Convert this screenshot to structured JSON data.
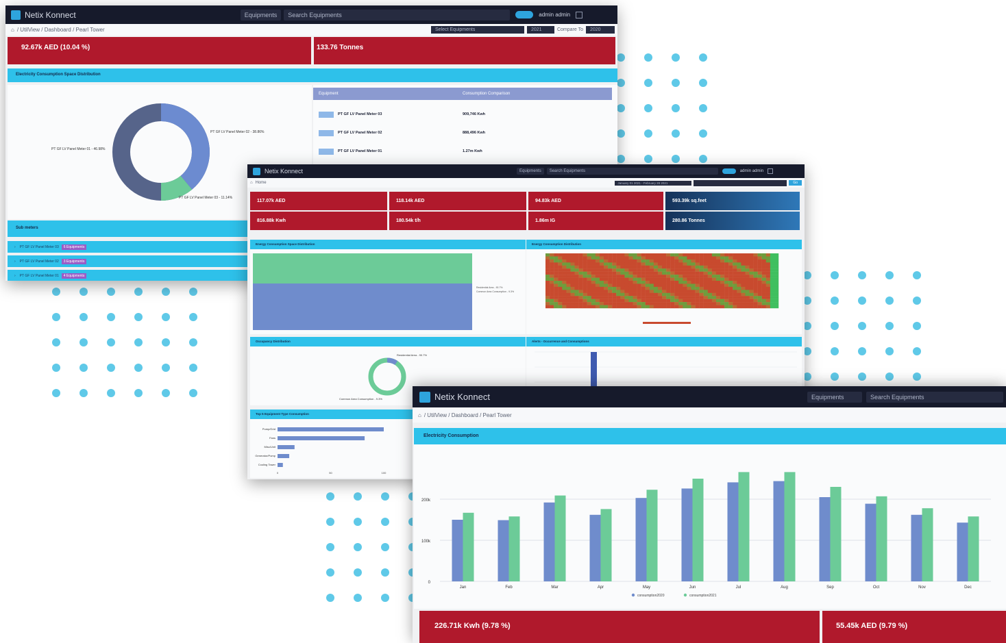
{
  "app": {
    "brand": "Netix Konnect"
  },
  "colors": {
    "accent": "#2ec1ea",
    "card_red": "#b0192c",
    "series_2020": "#6f8ccc",
    "series_2021": "#6ccb98",
    "topbar": "#161a2b"
  },
  "back": {
    "nav_equipments": "Equipments",
    "nav_search": "Search Equipments",
    "user": "admin admin",
    "breadcrumb": "/ UtilView / Dashboard / Pearl Tower",
    "filter_equipment": "Select Equipments",
    "filter_year": "2021",
    "compare_label": "Compare To",
    "compare_year": "2020",
    "card1": {
      "value": "92.67k AED (10.04 %)"
    },
    "card2": {
      "value": "133.76 Tonnes"
    },
    "section_title": "Electricity Consumption Space Distribution",
    "donut_labels": [
      "PT GF LV Panel Meter 01 - 46.98%",
      "PT GF LV Panel Meter 02 - 38.86%",
      "PT GF LV Panel Meter 03 - 11.14%"
    ],
    "table_headers": [
      "Equipment",
      "Consumption Comparison"
    ],
    "table_rows": [
      {
        "name": "PT GF LV Panel Meter 03",
        "value": "909,746 Kwh"
      },
      {
        "name": "PT GF LV Panel Meter 02",
        "value": "888,496 Kwh"
      },
      {
        "name": "PT GF LV Panel Meter 01",
        "value": "1.27m Kwh"
      }
    ],
    "sub_meters_title": "Sub meters",
    "sub_rows": [
      {
        "name": "PT GF LV Panel Meter 03",
        "badge": "6 Equipments"
      },
      {
        "name": "PT GF LV Panel Meter 02",
        "badge": "3 Equipments"
      },
      {
        "name": "PT GF LV Panel Meter 01",
        "badge": "4 Equipments"
      }
    ]
  },
  "middle": {
    "nav_equipments": "Equipments",
    "nav_search": "Search Equipments",
    "user": "admin admin",
    "breadcrumb": "Home",
    "date_range": "January 01 2021 - February 28 2021",
    "action": "Go",
    "kpis": [
      {
        "value": "117.07k AED"
      },
      {
        "value": "118.14k AED"
      },
      {
        "value": "94.83k AED"
      },
      {
        "value": "593.39k sq.feet"
      },
      {
        "value": "816.88k Kwh"
      },
      {
        "value": "180.54k t/h"
      },
      {
        "value": "1.86m IG"
      },
      {
        "value": "280.86 Tonnes"
      }
    ],
    "panels": {
      "space": "Energy Consumption Space Distribution",
      "heatmap": "Energy Consumption Distribution",
      "occupancy": "Occupancy Distribution",
      "top": "Top 5 Equipment Type Consumption",
      "alerts": "Alerts - Occurrence and Consumptions"
    },
    "donut_labels": [
      "Residential Area - 90.7%",
      "Common Area Consumption - 9.3%"
    ],
    "hbar_categories": [
      "Pump/Grid",
      "Fans",
      "Misc/Unit",
      "Generator/Pump",
      "Cooling Tower"
    ],
    "hbar_values": [
      100,
      82,
      16,
      11,
      5
    ],
    "hbar_ticks": [
      "0",
      "50",
      "100"
    ]
  },
  "front": {
    "nav_equipments": "Equipments",
    "nav_search": "Search Equipments",
    "breadcrumb": "/ UtilView / Dashboard / Pearl Tower",
    "section_title": "Electricity Consumption",
    "card1": {
      "value": "226.71k Kwh (9.78 %)"
    },
    "card2": {
      "value": "55.45k AED (9.79 %)"
    }
  },
  "chart_data": {
    "type": "bar",
    "categories": [
      "Jan",
      "Feb",
      "Mar",
      "Apr",
      "May",
      "Jun",
      "Jul",
      "Aug",
      "Sep",
      "Oct",
      "Nov",
      "Dec"
    ],
    "series": [
      {
        "name": "consumption2020",
        "values": [
          150,
          149,
          192,
          162,
          203,
          226,
          241,
          244,
          205,
          189,
          162,
          143
        ]
      },
      {
        "name": "consumption2021",
        "values": [
          167,
          158,
          209,
          176,
          223,
          250,
          266,
          266,
          230,
          207,
          178,
          158
        ]
      }
    ],
    "yticks": [
      "0",
      "100k",
      "200k"
    ],
    "ylim": [
      0,
      300
    ],
    "legend_position": "bottom",
    "grid": true
  }
}
